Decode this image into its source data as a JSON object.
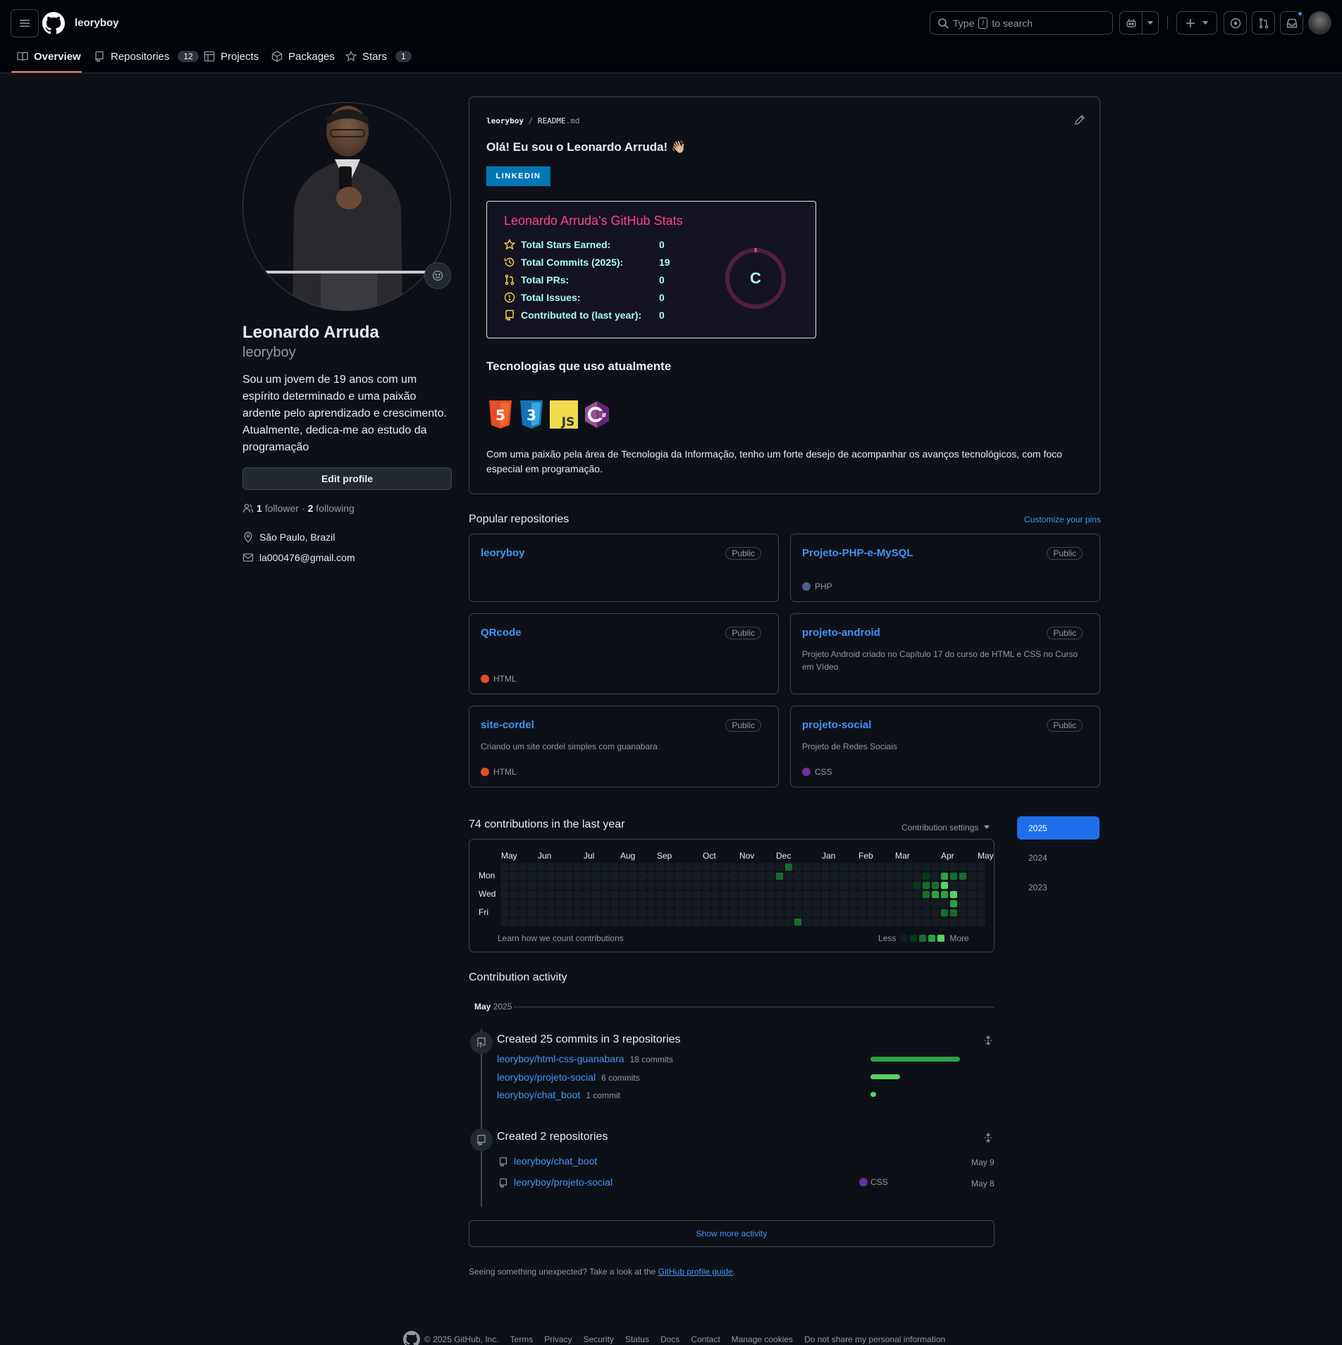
{
  "header": {
    "username": "leoryboy",
    "search_placeholder_pre": "Type",
    "search_key": "/",
    "search_placeholder_post": "to search"
  },
  "tabs": [
    {
      "label": "Overview"
    },
    {
      "label": "Repositories",
      "count": "12"
    },
    {
      "label": "Projects"
    },
    {
      "label": "Packages"
    },
    {
      "label": "Stars",
      "count": "1"
    }
  ],
  "profile": {
    "name": "Leonardo Arruda",
    "login": "leoryboy",
    "bio": "Sou um jovem de 19 anos com um espírito determinado e uma paixão ardente pelo aprendizado e crescimento. Atualmente, dedica-me ao estudo da programação",
    "edit_button": "Edit profile",
    "followers_count": "1",
    "followers_label": "follower",
    "sep": "·",
    "following_count": "2",
    "following_label": "following",
    "location": "São Paulo, Brazil",
    "email": "la000476@gmail.com"
  },
  "readme": {
    "path_user": "leoryboy",
    "path_sep": "/",
    "path_file": "README",
    "path_ext": ".md",
    "greeting": "Olá! Eu sou o Leonardo Arruda! 👋🏼",
    "linkedin_badge": "LINKEDIN",
    "stats_title": "Leonardo Arruda's GitHub Stats",
    "stats": [
      {
        "label": "Total Stars Earned:",
        "value": "0"
      },
      {
        "label": "Total Commits (2025):",
        "value": "19"
      },
      {
        "label": "Total PRs:",
        "value": "0"
      },
      {
        "label": "Total Issues:",
        "value": "0"
      },
      {
        "label": "Contributed to (last year):",
        "value": "0"
      }
    ],
    "rank": "C",
    "tech_heading": "Tecnologias que uso atualmente",
    "tech_icons": [
      "html5-icon",
      "css3-icon",
      "javascript-icon",
      "csharp-icon"
    ],
    "tech_js_label": "JS",
    "paragraph": "Com uma paixão pela área de Tecnologia da Informação, tenho um forte desejo de acompanhar os avanços tecnológicos, com foco especial em programação."
  },
  "popular": {
    "heading": "Popular repositories",
    "customize": "Customize your pins",
    "repos": [
      {
        "name": "leoryboy",
        "visibility": "Public",
        "desc": "",
        "lang": "",
        "lang_color": ""
      },
      {
        "name": "Projeto-PHP-e-MySQL",
        "visibility": "Public",
        "desc": "",
        "lang": "PHP",
        "lang_color": "#4F5D95"
      },
      {
        "name": "QRcode",
        "visibility": "Public",
        "desc": "",
        "lang": "HTML",
        "lang_color": "#e34c26"
      },
      {
        "name": "projeto-android",
        "visibility": "Public",
        "desc": "Projeto Android criado no Capítulo 17 do curso de HTML e CSS no Curso em Vídeo",
        "lang": "",
        "lang_color": ""
      },
      {
        "name": "site-cordel",
        "visibility": "Public",
        "desc": "Criando um site cordel simples com guanabara",
        "lang": "HTML",
        "lang_color": "#e34c26"
      },
      {
        "name": "projeto-social",
        "visibility": "Public",
        "desc": "Projeto de Redes Sociais",
        "lang": "CSS",
        "lang_color": "#663399"
      }
    ]
  },
  "contributions": {
    "heading": "74 contributions in the last year",
    "settings": "Contribution settings",
    "months": [
      "May",
      "Jun",
      "Jul",
      "Aug",
      "Sep",
      "Oct",
      "Nov",
      "Dec",
      "Jan",
      "Feb",
      "Mar",
      "Apr",
      "May"
    ],
    "days": [
      "Mon",
      "Wed",
      "Fri"
    ],
    "learn": "Learn how we count contributions",
    "less": "Less",
    "more": "More",
    "years": [
      "2025",
      "2024",
      "2023"
    ],
    "active_cells": [
      {
        "week": 30,
        "day": 1,
        "level": 2
      },
      {
        "week": 31,
        "day": 0,
        "level": 2
      },
      {
        "week": 32,
        "day": 6,
        "level": 2
      },
      {
        "week": 45,
        "day": 2,
        "level": 1
      },
      {
        "week": 46,
        "day": 1,
        "level": 1
      },
      {
        "week": 46,
        "day": 2,
        "level": 2
      },
      {
        "week": 46,
        "day": 3,
        "level": 2
      },
      {
        "week": 47,
        "day": 2,
        "level": 2
      },
      {
        "week": 47,
        "day": 3,
        "level": 3
      },
      {
        "week": 48,
        "day": 1,
        "level": 3
      },
      {
        "week": 48,
        "day": 2,
        "level": 4
      },
      {
        "week": 48,
        "day": 3,
        "level": 3
      },
      {
        "week": 48,
        "day": 5,
        "level": 2
      },
      {
        "week": 49,
        "day": 1,
        "level": 2
      },
      {
        "week": 49,
        "day": 3,
        "level": 4
      },
      {
        "week": 49,
        "day": 4,
        "level": 3
      },
      {
        "week": 49,
        "day": 5,
        "level": 2
      },
      {
        "week": 50,
        "day": 1,
        "level": 2
      }
    ]
  },
  "activity": {
    "heading": "Contribution activity",
    "month": "May",
    "year": "2025",
    "commits_title": "Created 25 commits in 3 repositories",
    "commit_repos": [
      {
        "name": "leoryboy/html-css-guanabara",
        "count": "18 commits",
        "fraction": 1.0
      },
      {
        "name": "leoryboy/projeto-social",
        "count": "6 commits",
        "fraction": 0.33
      },
      {
        "name": "leoryboy/chat_boot",
        "count": "1 commit",
        "fraction": 0.06
      }
    ],
    "repos_title": "Created 2 repositories",
    "created_repos": [
      {
        "name": "leoryboy/chat_boot",
        "lang": "",
        "date": "May 9"
      },
      {
        "name": "leoryboy/projeto-social",
        "lang": "CSS",
        "date": "May 8"
      }
    ],
    "show_more": "Show more activity",
    "unexpected_pre": "Seeing something unexpected? Take a look at the",
    "unexpected_link": "GitHub profile guide",
    "unexpected_post": "."
  },
  "footer": {
    "copyright": "© 2025 GitHub, Inc.",
    "links": [
      "Terms",
      "Privacy",
      "Security",
      "Status",
      "Docs",
      "Contact",
      "Manage cookies",
      "Do not share my personal information"
    ]
  },
  "colors": {
    "accent": "#1f6feb",
    "link": "#4493f8",
    "stats_title": "#fe428e",
    "stats_value": "#a9fef7",
    "green1": "#033a16",
    "green2": "#196c2e",
    "green3": "#2ea043",
    "green4": "#56d364"
  }
}
